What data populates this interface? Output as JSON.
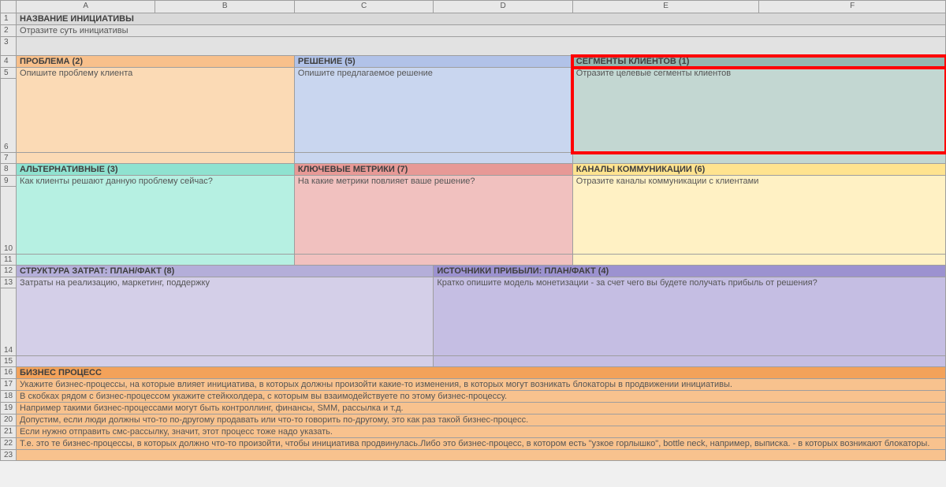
{
  "cols": [
    "",
    "A",
    "B",
    "C",
    "D",
    "E",
    "F"
  ],
  "rows": [
    "1",
    "2",
    "3",
    "4",
    "5",
    "6",
    "7",
    "8",
    "9",
    "10",
    "11",
    "12",
    "13",
    "14",
    "15",
    "16",
    "17",
    "18",
    "19",
    "20",
    "21",
    "22",
    "23"
  ],
  "title_h": "НАЗВАНИЕ ИНИЦИАТИВЫ",
  "title_b": "Отразите суть инициативы",
  "problem_h": "ПРОБЛЕМА (2)",
  "problem_b": "Опишите проблему клиента",
  "solution_h": "РЕШЕНИЕ (5)",
  "solution_b": "Опишите предлагаемое решение",
  "segments_h": "СЕГМЕНТЫ КЛИЕНТОВ (1)",
  "segments_b": "Отразите целевые сегменты клиентов",
  "alt_h": "АЛЬТЕРНАТИВНЫЕ (3)",
  "alt_b": "Как клиенты решают данную проблему сейчас?",
  "metrics_h": "КЛЮЧЕВЫЕ МЕТРИКИ (7)",
  "metrics_b": "На какие метрики повлияет ваше решение?",
  "channels_h": "КАНАЛЫ КОММУНИКАЦИИ (6)",
  "channels_b": "Отразите каналы коммуникации с клиентами",
  "cost_h": "СТРУКТУРА ЗАТРАТ: ПЛАН/ФАКТ (8)",
  "cost_b": "Затраты на реализацию, маркетинг, поддержку",
  "rev_h": "ИСТОЧНИКИ ПРИБЫЛИ: ПЛАН/ФАКТ (4)",
  "rev_b": "Кратко опишите модель монетизации - за счет чего вы будете получать прибыль от решения?",
  "bp_h": "БИЗНЕС ПРОЦЕСС",
  "bp_1": "Укажите бизнес-процессы, на которые влияет инициатива, в которых должны произойти какие-то изменения, в которых могут возникать блокаторы в продвижении инициативы.",
  "bp_2": "В скобках рядом с бизнес-процессом укажите стейкхолдера, с которым вы взаимодействуете по этому бизнес-процессу.",
  "bp_3": "Например такими бизнес-процессами могут быть контроллинг, финансы, SMM, рассылка и т.д.",
  "bp_4": "Допустим, если люди должны что-то по-другому продавать или что-то говорить по-другому, это как раз такой бизнес-процесс.",
  "bp_5": "Если нужно отправить смс-рассылку, значит, этот процесс тоже надо указать.",
  "bp_6": "Т.е. это те бизнес-процессы, в которых должно что-то произойти, чтобы инициатива продвинулась.Либо это бизнес-процесс, в котором есть \"узкое горлышко\", bottle neck, например, выписка. - в которых возникают блокаторы."
}
